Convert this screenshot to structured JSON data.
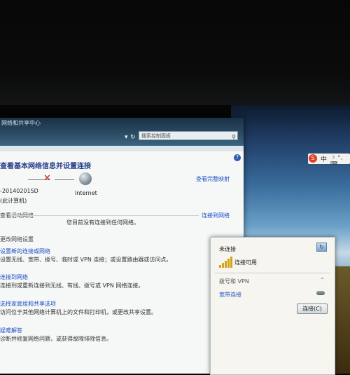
{
  "window": {
    "title_partial": "网络和共享中心",
    "search_placeholder": "搜索控制面板",
    "heading": "查看基本网络信息并设置连接",
    "full_map_link": "查看完整映射",
    "computer_name": "-20140201SD",
    "computer_sub": "(此计算机)",
    "internet_label": "Internet",
    "active_networks_label": "查看活动网络",
    "connect_to_network_link": "连接到网络",
    "no_connection_text": "您目前没有连接到任何网络。",
    "change_settings_label": "更改网络设置",
    "tasks": [
      {
        "title": "设置新的连接或网络",
        "desc": "设置无线、宽带、拨号、临时或 VPN 连接；或设置路由器或访问点。"
      },
      {
        "title": "连接到网络",
        "desc": "连接到或重新连接到无线、有线、拨号或 VPN 网络连接。"
      },
      {
        "title": "选择家庭组和共享选项",
        "desc": "访问位于其他网络计算机上的文件和打印机，或更改共享设置。"
      },
      {
        "title": "疑难解答",
        "desc": "诊断并修复网络问题，或获得故障排除信息。"
      }
    ]
  },
  "flyout": {
    "status": "未连接",
    "availability": "连接可用",
    "section": "拨号和 VPN",
    "item": "宽带连接",
    "connect_button": "连接(C)"
  },
  "tray": {
    "ime_label": "S",
    "lang": "中",
    "icons": "☽ °, ⌨"
  }
}
